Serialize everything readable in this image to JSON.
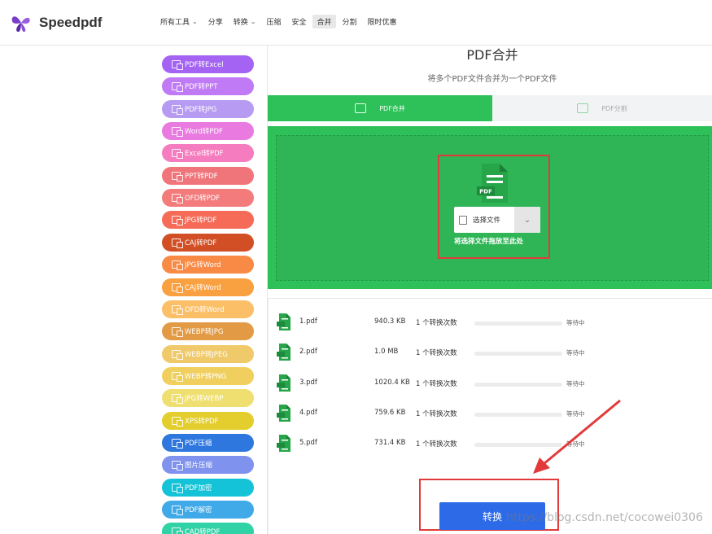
{
  "header": {
    "logo_text": "Speedpdf",
    "nav": [
      {
        "label": "所有工具",
        "dropdown": true,
        "active": false
      },
      {
        "label": "分享",
        "dropdown": false,
        "active": false
      },
      {
        "label": "转换",
        "dropdown": true,
        "active": false
      },
      {
        "label": "压缩",
        "dropdown": false,
        "active": false
      },
      {
        "label": "安全",
        "dropdown": false,
        "active": false
      },
      {
        "label": "合并",
        "dropdown": false,
        "active": true
      },
      {
        "label": "分割",
        "dropdown": false,
        "active": false
      },
      {
        "label": "限时优惠",
        "dropdown": false,
        "active": false
      }
    ]
  },
  "sidebar": {
    "items": [
      {
        "label": "PDF转Excel",
        "color": "#a463f2"
      },
      {
        "label": "PDF转PPT",
        "color": "#c07af5"
      },
      {
        "label": "PDF转JPG",
        "color": "#b79af2"
      },
      {
        "label": "Word转PDF",
        "color": "#e97ae0"
      },
      {
        "label": "Excel转PDF",
        "color": "#f57dbf"
      },
      {
        "label": "PPT转PDF",
        "color": "#f0757a"
      },
      {
        "label": "OFD转PDF",
        "color": "#f37b7b"
      },
      {
        "label": "JPG转PDF",
        "color": "#f56b58"
      },
      {
        "label": "CAJ转PDF",
        "color": "#d24f26"
      },
      {
        "label": "JPG转Word",
        "color": "#f88a45"
      },
      {
        "label": "CAJ转Word",
        "color": "#f9a040"
      },
      {
        "label": "OFD转Word",
        "color": "#fbbf68"
      },
      {
        "label": "WEBP转JPG",
        "color": "#e29a45"
      },
      {
        "label": "WEBP转JPEG",
        "color": "#f0c96a"
      },
      {
        "label": "WEBP转PNG",
        "color": "#f0cf5e"
      },
      {
        "label": "JPG转WEBP",
        "color": "#efdf70"
      },
      {
        "label": "XPS转PDF",
        "color": "#e3ce2e"
      },
      {
        "label": "PDF压缩",
        "color": "#2e77de"
      },
      {
        "label": "图片压缩",
        "color": "#7e92ee"
      },
      {
        "label": "PDF加密",
        "color": "#15c3d8"
      },
      {
        "label": "PDF解密",
        "color": "#40a9e8"
      },
      {
        "label": "CAD转PDF",
        "color": "#31d2a6"
      }
    ]
  },
  "main": {
    "title": "PDF合并",
    "subtitle": "将多个PDF文件合并为一个PDF文件",
    "tabs": [
      {
        "label": "PDF合并",
        "active": true
      },
      {
        "label": "PDF分割",
        "active": false
      }
    ],
    "file_icon_label": "PDF",
    "choose_label": "选择文件",
    "drop_hint": "将选择文件拖放至此处",
    "files": [
      {
        "name": "1.pdf",
        "size": "940.3 KB",
        "count": "1 个转换次数",
        "status": "等待中"
      },
      {
        "name": "2.pdf",
        "size": "1.0 MB",
        "count": "1 个转换次数",
        "status": "等待中"
      },
      {
        "name": "3.pdf",
        "size": "1020.4 KB",
        "count": "1 个转换次数",
        "status": "等待中"
      },
      {
        "name": "4.pdf",
        "size": "759.6 KB",
        "count": "1 个转换次数",
        "status": "等待中"
      },
      {
        "name": "5.pdf",
        "size": "731.4 KB",
        "count": "1 个转换次数",
        "status": "等待中"
      }
    ],
    "convert_label": "转换"
  },
  "watermark": "https://blog.csdn.net/cocowei0306",
  "colors": {
    "green": "#2fc159",
    "blue": "#2d6ae8",
    "annotation_red": "#e23a3a"
  }
}
